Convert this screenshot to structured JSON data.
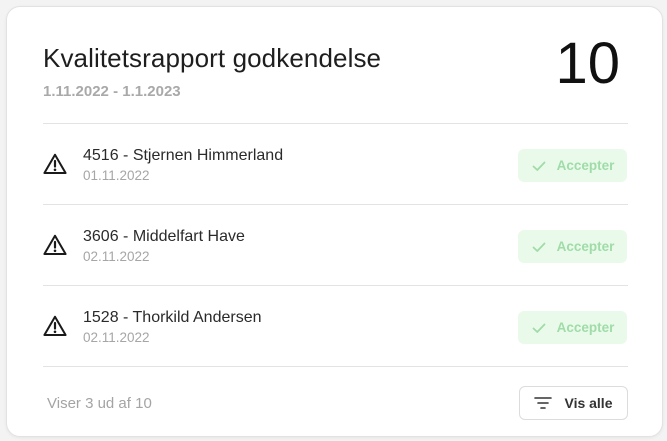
{
  "header": {
    "title": "Kvalitetsrapport godkendelse",
    "date_range": "1.11.2022 - 1.1.2023",
    "count": "10"
  },
  "items": [
    {
      "name": "4516 - Stjernen Himmerland",
      "date": "01.11.2022",
      "action_label": "Accepter"
    },
    {
      "name": "3606 - Middelfart Have",
      "date": "02.11.2022",
      "action_label": "Accepter"
    },
    {
      "name": "1528 - Thorkild Andersen",
      "date": "02.11.2022",
      "action_label": "Accepter"
    }
  ],
  "footer": {
    "summary": "Viser 3 ud af 10",
    "show_all_label": "Vis alle"
  },
  "colors": {
    "accept_bg": "#eafaea",
    "accept_text": "#9fdca8",
    "muted_text": "#a6a6a6"
  },
  "icons": {
    "row_icon": "warning-triangle-icon",
    "accept_icon": "check-icon",
    "show_all_icon": "filter-lines-icon"
  }
}
